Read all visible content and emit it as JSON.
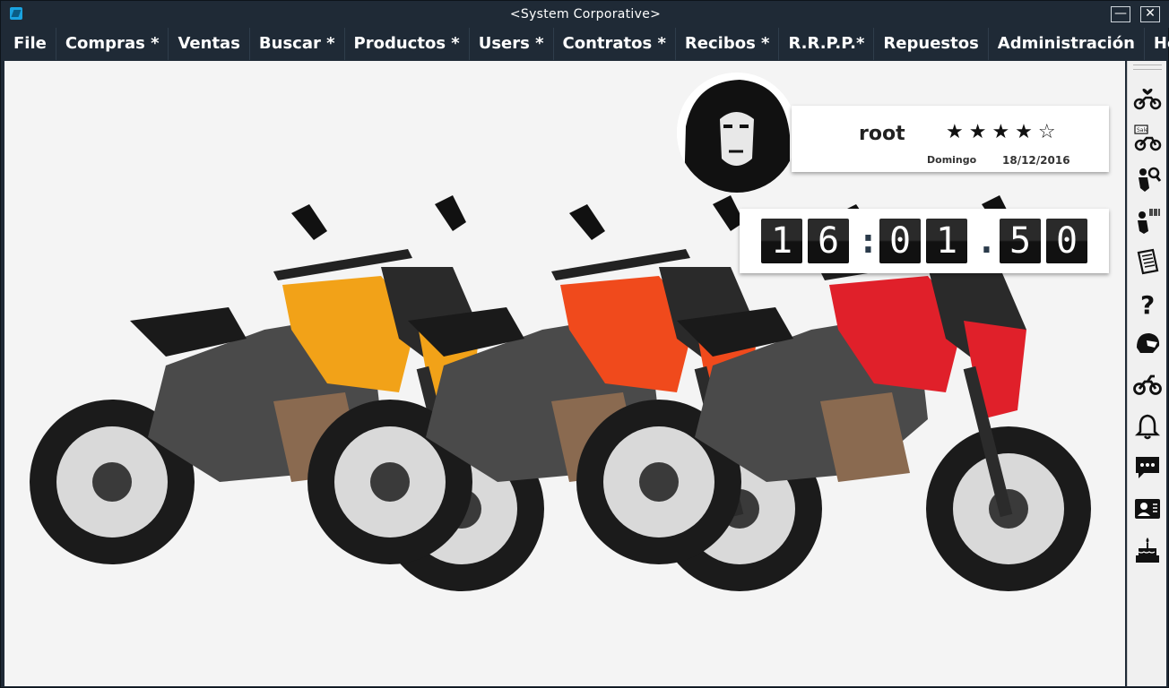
{
  "window": {
    "title": "<System Corporative>",
    "minimize": "—",
    "close": "✕"
  },
  "menu": [
    "File",
    "Compras *",
    "Ventas",
    "Buscar *",
    "Productos *",
    "Users *",
    "Contratos *",
    "Recibos *",
    "R.R.P.P.*",
    "Repuestos",
    "Administración",
    "Help *"
  ],
  "user": {
    "name": "root",
    "rating": 4,
    "rating_max": 5,
    "stars": "★★★★☆",
    "day": "Domingo",
    "date": "18/12/2016"
  },
  "clock": {
    "h1": "1",
    "h2": "6",
    "sep1": ":",
    "m1": "0",
    "m2": "1",
    "sep2": ".",
    "s1": "5",
    "s2": "0"
  },
  "sidebar_icons": [
    "favorite-motorcycle-icon",
    "sale-motorcycle-icon",
    "search-rider-icon",
    "barcode-rider-icon",
    "document-icon",
    "help-icon",
    "helmet-icon",
    "motorcycle-icon",
    "bell-icon",
    "chat-icon",
    "contact-card-icon",
    "birthday-cake-icon"
  ],
  "colors": {
    "chrome": "#1f2a36",
    "content_bg": "#f4f4f4",
    "bike_orange": "#f2a218",
    "bike_redorange": "#f04a1c",
    "bike_red": "#e0202a"
  }
}
